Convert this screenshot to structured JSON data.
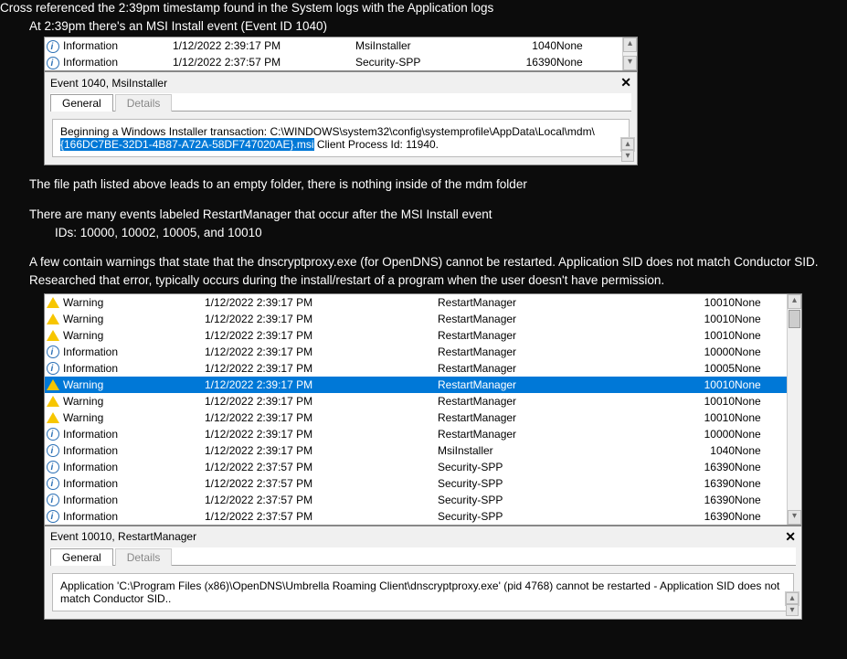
{
  "doc": {
    "l1": "Cross referenced the 2:39pm timestamp found in the System logs with the Application logs",
    "l2": "At 2:39pm there's an MSI Install event (Event ID 1040)",
    "l3": "The file path listed above leads to an empty folder, there is nothing inside of the mdm folder",
    "l4": "There are many events labeled RestartManager that occur after the MSI Install event",
    "l5": "IDs: 10000, 10002, 10005, and 10010",
    "l6": "A few contain warnings that state that the dnscryptproxy.exe (for OpenDNS) cannot be restarted. Application SID does not match Conductor SID.",
    "l7": "Researched that error, typically occurs during the install/restart of a program when the user doesn't have permission."
  },
  "labels": {
    "information": "Information",
    "warning": "Warning",
    "none": "None"
  },
  "top_list": [
    {
      "level": "info",
      "date": "1/12/2022 2:39:17 PM",
      "src": "MsiInstaller",
      "id": "1040",
      "cat": "None"
    },
    {
      "level": "info",
      "date": "1/12/2022 2:37:57 PM",
      "src": "Security-SPP",
      "id": "16390",
      "cat": "None"
    }
  ],
  "ev1040": {
    "title": "Event 1040, MsiInstaller",
    "tab_general": "General",
    "tab_details": "Details",
    "msg_pre": "Beginning a Windows Installer transaction: C:\\WINDOWS\\system32\\config\\systemprofile\\AppData\\Local\\mdm\\",
    "msg_hl": "{166DC7BE-32D1-4B87-A72A-58DF747020AE}.msi",
    "msg_post": " Client Process Id: 11940."
  },
  "main_list": [
    {
      "level": "warn",
      "date": "1/12/2022 2:39:17 PM",
      "src": "RestartManager",
      "id": "10010",
      "cat": "None",
      "sel": false
    },
    {
      "level": "warn",
      "date": "1/12/2022 2:39:17 PM",
      "src": "RestartManager",
      "id": "10010",
      "cat": "None",
      "sel": false
    },
    {
      "level": "warn",
      "date": "1/12/2022 2:39:17 PM",
      "src": "RestartManager",
      "id": "10010",
      "cat": "None",
      "sel": false
    },
    {
      "level": "info",
      "date": "1/12/2022 2:39:17 PM",
      "src": "RestartManager",
      "id": "10000",
      "cat": "None",
      "sel": false
    },
    {
      "level": "info",
      "date": "1/12/2022 2:39:17 PM",
      "src": "RestartManager",
      "id": "10005",
      "cat": "None",
      "sel": false
    },
    {
      "level": "warn",
      "date": "1/12/2022 2:39:17 PM",
      "src": "RestartManager",
      "id": "10010",
      "cat": "None",
      "sel": true
    },
    {
      "level": "warn",
      "date": "1/12/2022 2:39:17 PM",
      "src": "RestartManager",
      "id": "10010",
      "cat": "None",
      "sel": false
    },
    {
      "level": "warn",
      "date": "1/12/2022 2:39:17 PM",
      "src": "RestartManager",
      "id": "10010",
      "cat": "None",
      "sel": false
    },
    {
      "level": "info",
      "date": "1/12/2022 2:39:17 PM",
      "src": "RestartManager",
      "id": "10000",
      "cat": "None",
      "sel": false
    },
    {
      "level": "info",
      "date": "1/12/2022 2:39:17 PM",
      "src": "MsiInstaller",
      "id": "1040",
      "cat": "None",
      "sel": false
    },
    {
      "level": "info",
      "date": "1/12/2022 2:37:57 PM",
      "src": "Security-SPP",
      "id": "16390",
      "cat": "None",
      "sel": false
    },
    {
      "level": "info",
      "date": "1/12/2022 2:37:57 PM",
      "src": "Security-SPP",
      "id": "16390",
      "cat": "None",
      "sel": false
    },
    {
      "level": "info",
      "date": "1/12/2022 2:37:57 PM",
      "src": "Security-SPP",
      "id": "16390",
      "cat": "None",
      "sel": false
    },
    {
      "level": "info",
      "date": "1/12/2022 2:37:57 PM",
      "src": "Security-SPP",
      "id": "16390",
      "cat": "None",
      "sel": false
    }
  ],
  "ev10010": {
    "title": "Event 10010, RestartManager",
    "tab_general": "General",
    "tab_details": "Details",
    "msg": "Application 'C:\\Program Files (x86)\\OpenDNS\\Umbrella Roaming Client\\dnscryptproxy.exe' (pid 4768) cannot be restarted - Application SID does not match Conductor SID.."
  }
}
